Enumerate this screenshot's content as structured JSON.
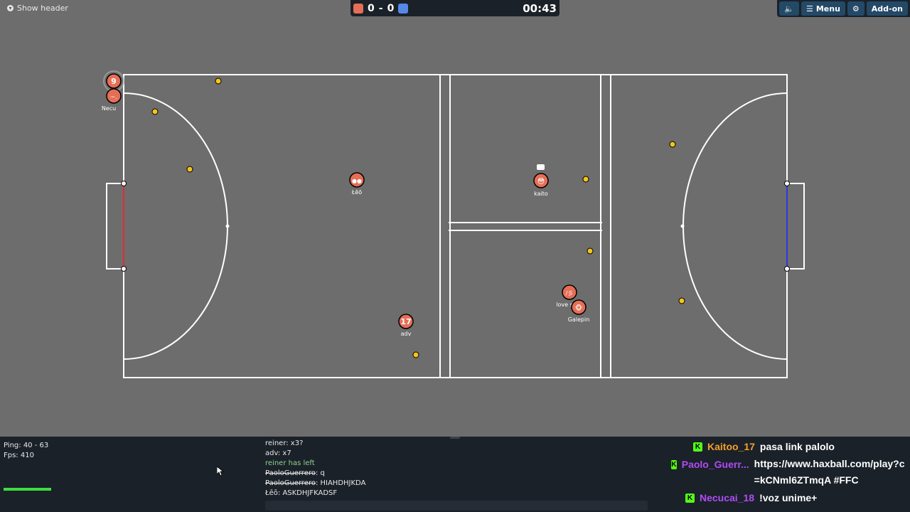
{
  "header": {
    "show_header_label": "Show header",
    "score_red": "0",
    "score_sep": "-",
    "score_blue": "0",
    "timer": "00:43",
    "menu_label": "Menu",
    "addon_label": "Add-on",
    "colors": {
      "red": "#e56e56",
      "blue": "#5689e5",
      "bar": "#1a2129",
      "button": "#244967"
    }
  },
  "players": [
    {
      "name": "Necu",
      "avatar": "~."
    },
    {
      "name": "",
      "avatar": "9"
    },
    {
      "name": "Łēō",
      "avatar": "●●"
    },
    {
      "name": "kaito",
      "avatar": "😳",
      "chat_bubble": "💬"
    },
    {
      "name": "adv",
      "avatar": "17"
    },
    {
      "name": "love s",
      "avatar": "/彡"
    },
    {
      "name": "Galepin",
      "avatar": "🐵"
    }
  ],
  "ball_color": "#f5c518",
  "stats": {
    "ping": "Ping: 40 - 63",
    "fps": "Fps: 410"
  },
  "chat": [
    {
      "text": "reiner: x3?",
      "kind": "normal"
    },
    {
      "text": "adv: x7",
      "kind": "normal"
    },
    {
      "text": "reiner has left",
      "kind": "notice"
    },
    {
      "name": "PaoloGuerrero",
      "text": ": q",
      "kind": "strike"
    },
    {
      "name": "PaoloGuerrero",
      "text": ": HIAHDHJKDA",
      "kind": "strike"
    },
    {
      "text": "Łēō: ASKDHJFKADSF",
      "kind": "normal"
    }
  ],
  "overlay_chat": [
    {
      "badge": "K",
      "user": "Kaitoo_17",
      "color": "#f59f2a",
      "text": "pasa link palolo"
    },
    {
      "badge": "K",
      "user": "Paolo_Guerr...",
      "color": "#b04cf5",
      "text": "https://www.haxball.com/play?c=kCNml6ZTmqA #FFC"
    },
    {
      "badge": "K",
      "user": "Necucai_18",
      "color": "#b04cf5",
      "text": "!voz unime+"
    }
  ]
}
